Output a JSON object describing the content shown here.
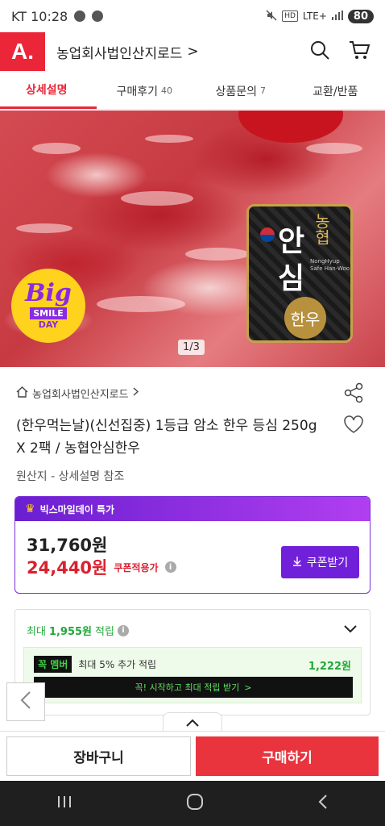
{
  "statusbar": {
    "carrier_time": "KT 10:28",
    "network": "LTE+",
    "hd": "HD",
    "battery": "80"
  },
  "header": {
    "logo": "A.",
    "store_title": "농업회사법인산지로드",
    "title_arrow": ">"
  },
  "tabs": [
    {
      "label": "상세설명",
      "count": ""
    },
    {
      "label": "구매후기",
      "count": "40"
    },
    {
      "label": "상품문의",
      "count": "7"
    },
    {
      "label": "교환/반품",
      "count": ""
    }
  ],
  "hero": {
    "page_indicator": "1/3",
    "badge_big": "Big",
    "badge_smile": "SMILE",
    "badge_day": "DAY",
    "brand_an": "안",
    "brand_sim": "심",
    "brand_nh": "농협",
    "brand_eng": "NongHyup Safe Han-Woo",
    "brand_hanwoo": "한우"
  },
  "product": {
    "store_name": "농업회사법인산지로드",
    "title": "(한우먹는날)(신선집중) 1등급 암소 한우 등심 250g X 2팩 / 농협안심한우",
    "origin": "원산지 - 상세설명 참조"
  },
  "price": {
    "promo_label": "빅스마일데이 특가",
    "original_price": "31,760원",
    "sale_price": "24,440원",
    "sale_note": "쿠폰적용가",
    "coupon_button": "쿠폰받기"
  },
  "points": {
    "prefix": "최대",
    "amount": "1,955원",
    "suffix": "적립",
    "member_badge_a": "꼭",
    "member_badge_b": "멤버",
    "member_text": "최대 5% 추가 적립",
    "member_amount": "1,222원",
    "member_cta": "꼭! 시작하고 최대 적립 받기",
    "member_cta_arrow": ">"
  },
  "bottom": {
    "cart": "장바구니",
    "buy": "구매하기"
  },
  "colors": {
    "brand_red": "#eb2638",
    "promo_purple": "#7020d9",
    "points_green": "#22a83a"
  }
}
